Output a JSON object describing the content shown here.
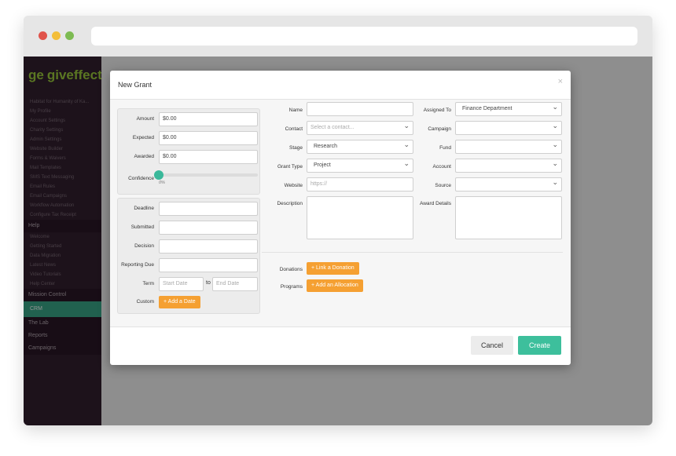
{
  "sidebar": {
    "brand": "giveffect",
    "brand_mark": "ge",
    "items_top": [
      "Habitat for Humanity of Ka...",
      "My Profile",
      "Account Settings",
      "Charity Settings",
      "Admin Settings",
      "Website Builder",
      "Forms & Waivers",
      "Mail Templates",
      "SMS Text Messaging",
      "Email Rules",
      "Email Campaigns",
      "Workflow Automation",
      "Configure Tax Receipt"
    ],
    "help_header": "Help",
    "items_help": [
      "Welcome",
      "Getting Started",
      "Data Migration",
      "Latest News",
      "Video Tutorials",
      "Help Center"
    ],
    "mission_control": "Mission Control",
    "crm": "CRM",
    "lab": "The Lab",
    "reports": "Reports",
    "campaigns": "Campaigns"
  },
  "modal": {
    "title": "New Grant",
    "close_icon": "close-icon",
    "amount": {
      "label": "Amount",
      "value": "$0.00"
    },
    "expected": {
      "label": "Expected",
      "value": "$0.00"
    },
    "awarded": {
      "label": "Awarded",
      "value": "$0.00"
    },
    "confidence": {
      "label": "Confidence",
      "value": "0%",
      "level": 0
    },
    "deadline": {
      "label": "Deadline",
      "value": ""
    },
    "submitted": {
      "label": "Submitted",
      "value": ""
    },
    "decision": {
      "label": "Decision",
      "value": ""
    },
    "reporting_due": {
      "label": "Reporting Due",
      "value": ""
    },
    "term": {
      "label": "Term",
      "start_placeholder": "Start Date",
      "to": "to",
      "end_placeholder": "End Date"
    },
    "custom": {
      "label": "Custom",
      "button": "+ Add a Date"
    },
    "name": {
      "label": "Name",
      "value": ""
    },
    "contact": {
      "label": "Contact",
      "placeholder": "Select a contact..."
    },
    "stage": {
      "label": "Stage",
      "value": "Research"
    },
    "grant_type": {
      "label": "Grant Type",
      "value": "Project"
    },
    "website": {
      "label": "Website",
      "placeholder": "https://"
    },
    "description": {
      "label": "Description"
    },
    "assigned_to": {
      "label": "Assigned To",
      "value": "Finance Department"
    },
    "campaign": {
      "label": "Campaign",
      "value": ""
    },
    "fund": {
      "label": "Fund",
      "value": ""
    },
    "account": {
      "label": "Account",
      "value": ""
    },
    "source": {
      "label": "Source",
      "value": ""
    },
    "award_details": {
      "label": "Award Details"
    },
    "donations": {
      "label": "Donations",
      "button": "+ Link a Donation"
    },
    "programs": {
      "label": "Programs",
      "button": "+ Add an Allocation"
    },
    "cancel": "Cancel",
    "create": "Create"
  },
  "colors": {
    "accent_green": "#3dbf9c",
    "orange": "#f5a032",
    "sidebar": "#331f2f"
  }
}
